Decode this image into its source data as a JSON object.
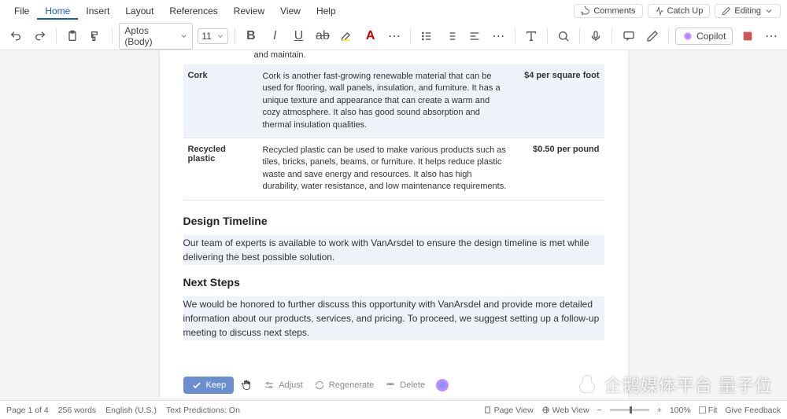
{
  "menu": {
    "items": [
      "File",
      "Home",
      "Insert",
      "Layout",
      "References",
      "Review",
      "View",
      "Help"
    ],
    "active_index": 1,
    "right": {
      "comments": "Comments",
      "catchup": "Catch Up",
      "editing": "Editing"
    }
  },
  "toolbar": {
    "font_name": "Aptos (Body)",
    "font_size": "11",
    "copilot_label": "Copilot"
  },
  "document": {
    "fragment_top": "and maintain.",
    "table_rows": [
      {
        "name": "Cork",
        "desc": "Cork is another fast-growing renewable material that can be used for flooring, wall panels, insulation, and furniture. It has a unique texture and appearance that can create a warm and cozy atmosphere. It also has good sound absorption and thermal insulation qualities.",
        "price": "$4 per square foot"
      },
      {
        "name": "Recycled plastic",
        "desc": "Recycled plastic can be used to make various products such as tiles, bricks, panels, beams, or furniture. It helps reduce plastic waste and save energy and resources. It also has high durability, water resistance, and low maintenance requirements.",
        "price": "$0.50 per pound"
      }
    ],
    "heading1": "Design Timeline",
    "para1": "Our team of experts is available to work with VanArsdel to ensure the design timeline is met while delivering the best possible solution.",
    "heading2": "Next Steps",
    "para2": "We would be honored to further discuss this opportunity with VanArsdel and provide more detailed information about our products, services, and pricing. To proceed, we suggest setting up a follow-up meeting to discuss next steps."
  },
  "aibar": {
    "keep": "Keep",
    "adjust": "Adjust",
    "regenerate": "Regenerate",
    "delete": "Delete"
  },
  "status": {
    "page": "Page 1 of 4",
    "words": "256 words",
    "lang": "English (U.S.)",
    "predictions": "Text Predictions: On",
    "page_view": "Page View",
    "web_view": "Web View",
    "zoom": "100%",
    "fit": "Fit",
    "feedback": "Give Feedback"
  },
  "watermark": "企鹅媒体平台 量子位"
}
